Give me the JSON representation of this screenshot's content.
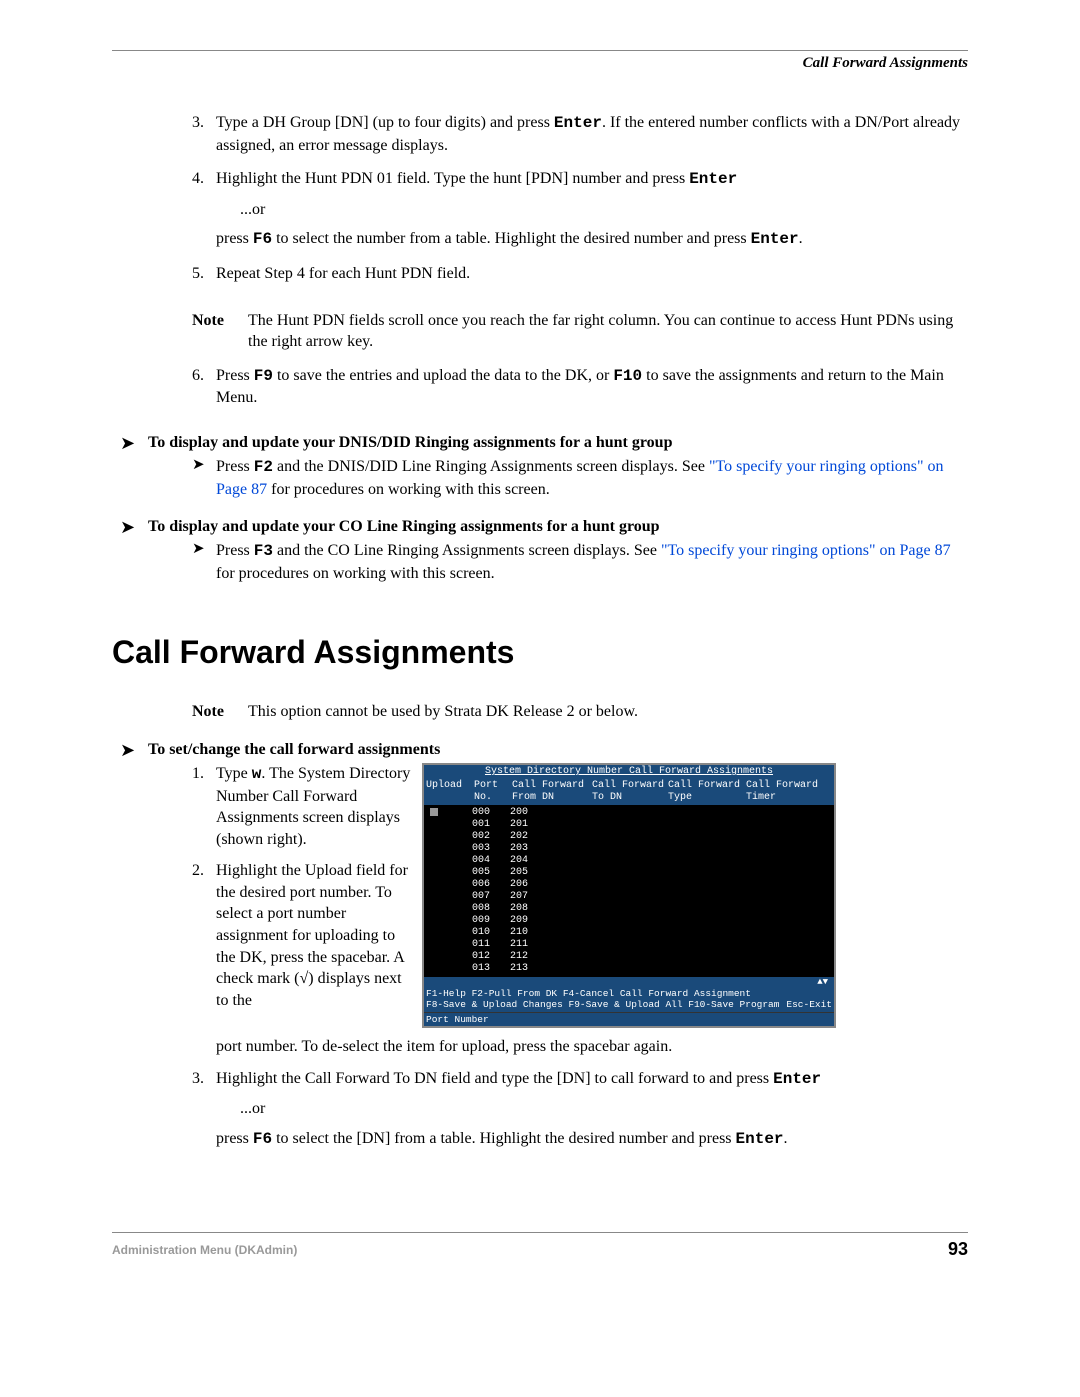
{
  "header": {
    "title": "Call Forward Assignments"
  },
  "steps_a": {
    "s3": {
      "num": "3.",
      "t1": "Type a DH Group [DN] (up to four digits) and press ",
      "kbd": "Enter",
      "t2": ". If the entered number conflicts with a DN/Port already assigned, an error message displays."
    },
    "s4": {
      "num": "4.",
      "t1": "Highlight the Hunt PDN 01 field. Type the hunt [PDN] number and press ",
      "kbd": "Enter",
      "or": "...or",
      "p2a": "press ",
      "kbd2": "F6",
      "p2b": " to select the number from a table. Highlight the desired number and press ",
      "kbd3": "Enter",
      "p2c": "."
    },
    "s5": {
      "num": "5.",
      "t": "Repeat Step 4 for each Hunt PDN field."
    },
    "note": {
      "label": "Note",
      "t": "The Hunt PDN fields scroll once you reach the far right column. You can continue to access Hunt PDNs using the right arrow key."
    },
    "s6": {
      "num": "6.",
      "t1": "Press ",
      "kbd1": "F9",
      "t2": " to save the entries and upload the data to the DK, or ",
      "kbd2": "F10",
      "t3": " to save the assignments and return to the Main Menu."
    }
  },
  "ah1": {
    "title": "To display and update your DNIS/DID Ringing assignments for a hunt group",
    "t1": "Press ",
    "kbd": "F2",
    "t2": " and the DNIS/DID Line Ringing Assignments screen displays. See ",
    "link": "\"To specify your ringing options\" on Page 87",
    "t3": " for procedures on working with this screen."
  },
  "ah2": {
    "title": "To display and update your CO Line Ringing assignments for a hunt group",
    "t1": "Press ",
    "kbd": "F3",
    "t2": " and the CO Line Ringing Assignments screen displays. See ",
    "link": "\"To specify your ringing options\" on Page 87",
    "t3": " for procedures on working with this screen."
  },
  "section": {
    "title": "Call Forward Assignments"
  },
  "note2": {
    "label": "Note",
    "t": "This option cannot be used by Strata DK Release 2 or below."
  },
  "ah3": {
    "title": "To set/change the call forward assignments"
  },
  "steps_b": {
    "s1": {
      "num": "1.",
      "t1": "Type ",
      "kbd": "w",
      "t2": ". The System Directory Number Call Forward Assignments screen displays (shown right)."
    },
    "s2": {
      "num": "2.",
      "t": "Highlight the Upload field for the desired port number. To select a port number assignment for uploading to the DK, press the spacebar. A check mark (√) displays next to the "
    },
    "s2_cont": "port number. To de-select the item for upload, press the spacebar again.",
    "s3": {
      "num": "3.",
      "t1": "Highlight the Call Forward To DN field and type the [DN] to call forward to and press ",
      "kbd": "Enter",
      "or": "...or",
      "p2a": "press ",
      "kbd2": "F6",
      "p2b": " to select the [DN] from a table. Highlight the desired number and press ",
      "kbd3": "Enter",
      "p2c": "."
    }
  },
  "terminal": {
    "title": "System Directory Number Call Forward Assignments",
    "headers": {
      "upload": "Upload",
      "port": "Port\nNo.",
      "cf_from": "Call Forward\nFrom DN",
      "cf_to": "Call Forward\nTo DN",
      "cf_type": "Call Forward\nType",
      "cf_timer": "Call Forward\nTimer"
    },
    "rows": [
      {
        "port": "000",
        "from": "200"
      },
      {
        "port": "001",
        "from": "201"
      },
      {
        "port": "002",
        "from": "202"
      },
      {
        "port": "003",
        "from": "203"
      },
      {
        "port": "004",
        "from": "204"
      },
      {
        "port": "005",
        "from": "205"
      },
      {
        "port": "006",
        "from": "206"
      },
      {
        "port": "007",
        "from": "207"
      },
      {
        "port": "008",
        "from": "208"
      },
      {
        "port": "009",
        "from": "209"
      },
      {
        "port": "010",
        "from": "210"
      },
      {
        "port": "011",
        "from": "211"
      },
      {
        "port": "012",
        "from": "212"
      },
      {
        "port": "013",
        "from": "213"
      }
    ],
    "scroll": "▲▼",
    "foot1_left": "F1-Help  F2-Pull From DK  F4-Cancel Call Forward Assignment",
    "foot2_left": "F8-Save & Upload Changes  F9-Save & Upload All  F10-Save Program",
    "foot2_right": "Esc-Exit",
    "status": "Port Number"
  },
  "footer": {
    "left": "Administration Menu (DKAdmin)",
    "right": "93"
  }
}
